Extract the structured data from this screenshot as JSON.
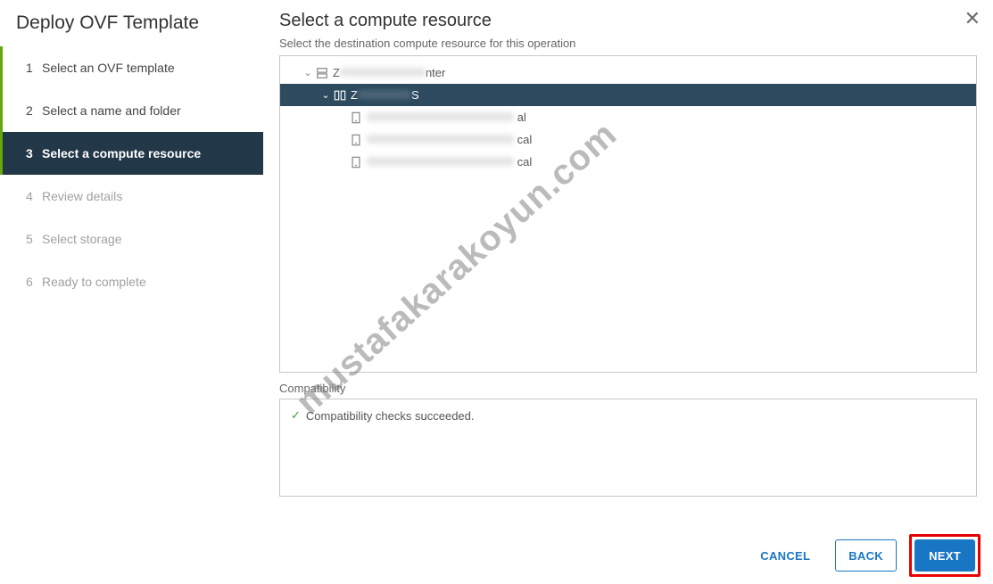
{
  "wizard": {
    "title": "Deploy OVF Template",
    "steps": [
      {
        "num": "1",
        "label": "Select an OVF template",
        "state": "completed"
      },
      {
        "num": "2",
        "label": "Select a name and folder",
        "state": "completed"
      },
      {
        "num": "3",
        "label": "Select a compute resource",
        "state": "active"
      },
      {
        "num": "4",
        "label": "Review details",
        "state": "future"
      },
      {
        "num": "5",
        "label": "Select storage",
        "state": "future"
      },
      {
        "num": "6",
        "label": "Ready to complete",
        "state": "future"
      }
    ]
  },
  "main": {
    "title": "Select a compute resource",
    "instruction": "Select the destination compute resource for this operation"
  },
  "tree": {
    "datacenter": {
      "prefix": "Z",
      "suffix": "nter"
    },
    "cluster": {
      "prefix": "Z",
      "suffix": "S"
    },
    "hosts": [
      {
        "suffix": "al"
      },
      {
        "suffix": "cal"
      },
      {
        "suffix": "cal"
      }
    ]
  },
  "compatibility": {
    "label": "Compatibility",
    "message": "Compatibility checks succeeded."
  },
  "buttons": {
    "cancel": "CANCEL",
    "back": "BACK",
    "next": "NEXT"
  },
  "watermark": "mustafakarakoyun.com"
}
